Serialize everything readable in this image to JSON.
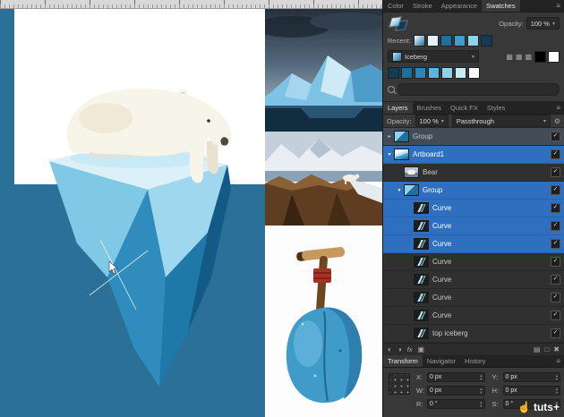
{
  "artwork_colors": {
    "sea": "#2b7096",
    "iceberg_top": "#dcf0f9",
    "iceberg_light": "#7fc9e6",
    "iceberg_mid": "#2f8cbd",
    "iceberg_dark": "#135a86",
    "bear": "#f7f4ea"
  },
  "swatches_panel": {
    "tabs": [
      {
        "label": "Color"
      },
      {
        "label": "Stroke"
      },
      {
        "label": "Appearance"
      },
      {
        "label": "Swatches",
        "active": true
      }
    ],
    "opacity_label": "Opacity:",
    "opacity_value": "100 %",
    "recent_label": "Recent:",
    "recent_swatches": [
      "linear-gradient(135deg,#ffffff,#1f6f9e)",
      "#e4f3fa",
      "#1f6f9e",
      "#3e9fce",
      "#8fd2ec",
      "#123c55"
    ],
    "palette_name": "Iceberg",
    "palette_swatches": [
      "#123c55",
      "#1f6f9e",
      "#2e86b8",
      "#5cb6dc",
      "#8fd2ec",
      "#c8e9f6",
      "#ffffff"
    ],
    "bw_swatches": [
      "#000000",
      "#ffffff"
    ],
    "library_icons": [
      {
        "name": "swatch-grid-icon",
        "glyph": "▦"
      },
      {
        "name": "swatch-grid-small-icon",
        "glyph": "▦"
      },
      {
        "name": "swatch-list-icon",
        "glyph": "▩"
      }
    ]
  },
  "layers_panel": {
    "tabs": [
      {
        "label": "Layers",
        "active": true
      },
      {
        "label": "Brushes"
      },
      {
        "label": "Quick FX"
      },
      {
        "label": "Styles"
      }
    ],
    "opacity_label": "Opacity:",
    "opacity_value": "100 %",
    "blend_mode": "Passthrough",
    "layers": [
      {
        "name": "Group",
        "kind": "group",
        "state": "dim",
        "indent": 0,
        "expanded": false
      },
      {
        "name": "Artboard1",
        "kind": "artboard",
        "state": "selected",
        "indent": 0,
        "expanded": true
      },
      {
        "name": "Bear",
        "kind": "image",
        "state": "normal",
        "indent": 1
      },
      {
        "name": "Group",
        "kind": "group",
        "state": "selected",
        "indent": 1,
        "expanded": true
      },
      {
        "name": "Curve",
        "kind": "curve",
        "state": "selected",
        "indent": 2
      },
      {
        "name": "Curve",
        "kind": "curve",
        "state": "selected",
        "indent": 2
      },
      {
        "name": "Curve",
        "kind": "curve",
        "state": "selected",
        "indent": 2
      },
      {
        "name": "Curve",
        "kind": "curve",
        "state": "normal",
        "indent": 2
      },
      {
        "name": "Curve",
        "kind": "curve",
        "state": "normal",
        "indent": 2
      },
      {
        "name": "Curve",
        "kind": "curve",
        "state": "normal",
        "indent": 2
      },
      {
        "name": "Curve",
        "kind": "curve",
        "state": "normal",
        "indent": 2
      },
      {
        "name": "top iceberg",
        "kind": "curve",
        "state": "normal",
        "indent": 2
      }
    ],
    "bottom_icons_left": [
      {
        "name": "mask-icon",
        "glyph": "◐"
      },
      {
        "name": "adjustments-icon",
        "glyph": "◑"
      },
      {
        "name": "fx-icon",
        "glyph": "fx"
      },
      {
        "name": "group-layers-icon",
        "glyph": "▣"
      }
    ],
    "bottom_icons_right": [
      {
        "name": "insert-target-icon",
        "glyph": "▤"
      },
      {
        "name": "add-layer-icon",
        "glyph": "□"
      },
      {
        "name": "delete-layer-icon",
        "glyph": "✖"
      }
    ]
  },
  "transform_panel": {
    "tabs": [
      {
        "label": "Transform",
        "active": true
      },
      {
        "label": "Navigator"
      },
      {
        "label": "History"
      }
    ],
    "fields": [
      {
        "label": "X:",
        "value": "0 px"
      },
      {
        "label": "Y:",
        "value": "0 px"
      },
      {
        "label": "W:",
        "value": "0 px"
      },
      {
        "label": "H:",
        "value": "0 px"
      },
      {
        "label": "R:",
        "value": "0 °"
      },
      {
        "label": "S:",
        "value": "0 °"
      }
    ]
  },
  "watermark": {
    "text": "tuts+"
  }
}
